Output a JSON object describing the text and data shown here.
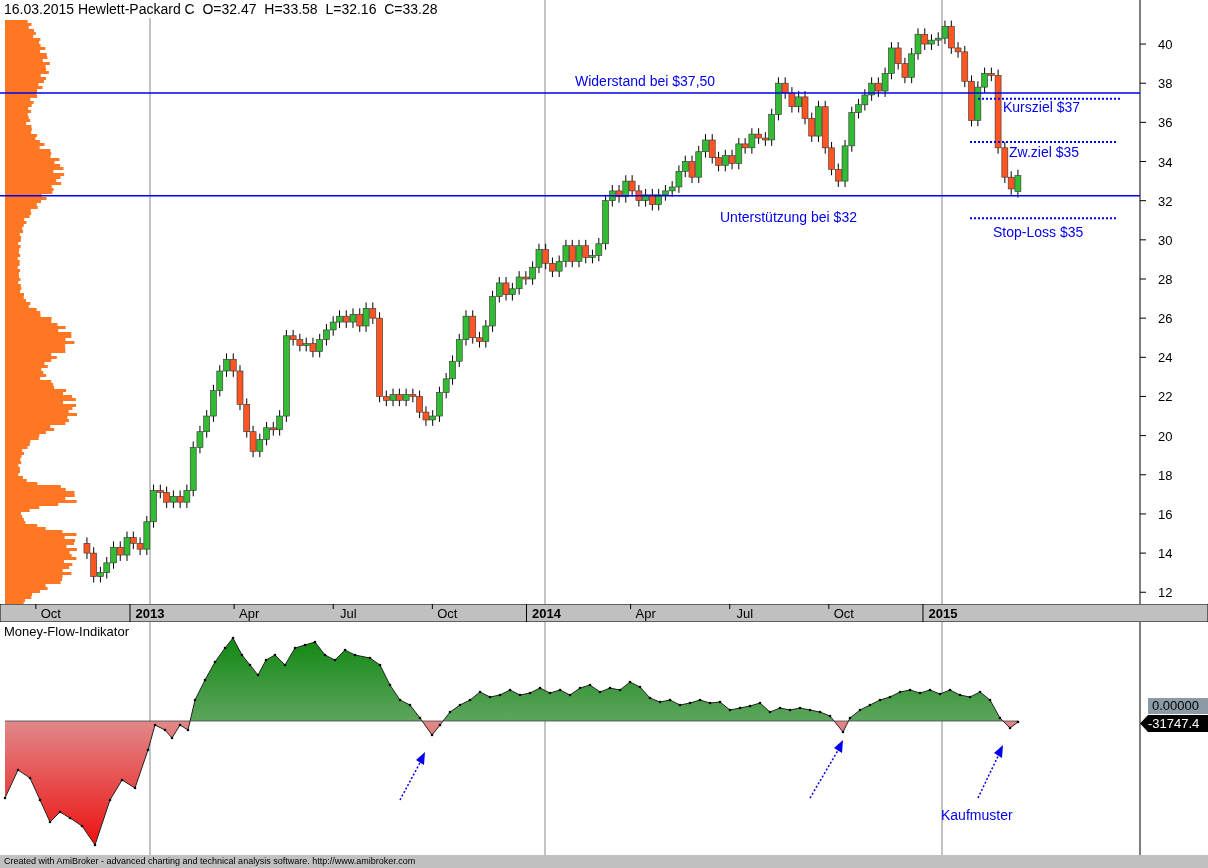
{
  "title": {
    "date": "16.03.2015",
    "symbol": "Hewlett-Packard C",
    "open": "O=32.47",
    "high": "H=33.58",
    "low": "L=32.16",
    "close": "C=33.28"
  },
  "price_chart": {
    "chart_data": {
      "type": "candlestick",
      "grid": true,
      "xlim": [
        2012.6217,
        2015.4969
      ],
      "ylim": [
        11.4,
        42.25
      ],
      "yticks": [
        12,
        14,
        16,
        18,
        20,
        22,
        24,
        26,
        28,
        30,
        32,
        34,
        36,
        38,
        40
      ],
      "x": [
        2012.841,
        2012.858,
        2012.875,
        2012.891,
        2012.908,
        2012.925,
        2012.942,
        2012.958,
        2012.975,
        2012.992,
        2013.009,
        2013.026,
        2013.042,
        2013.059,
        2013.076,
        2013.093,
        2013.109,
        2013.126,
        2013.143,
        2013.16,
        2013.176,
        2013.193,
        2013.21,
        2013.227,
        2013.244,
        2013.26,
        2013.277,
        2013.294,
        2013.311,
        2013.327,
        2013.344,
        2013.361,
        2013.378,
        2013.394,
        2013.411,
        2013.428,
        2013.445,
        2013.462,
        2013.478,
        2013.495,
        2013.512,
        2013.529,
        2013.545,
        2013.562,
        2013.579,
        2013.596,
        2013.613,
        2013.629,
        2013.646,
        2013.663,
        2013.68,
        2013.696,
        2013.713,
        2013.73,
        2013.747,
        2013.763,
        2013.78,
        2013.797,
        2013.814,
        2013.831,
        2013.847,
        2013.864,
        2013.881,
        2013.898,
        2013.914,
        2013.931,
        2013.948,
        2013.965,
        2013.981,
        2013.998,
        2014.015,
        2014.032,
        2014.049,
        2014.065,
        2014.082,
        2014.099,
        2014.116,
        2014.132,
        2014.149,
        2014.166,
        2014.183,
        2014.2,
        2014.216,
        2014.233,
        2014.25,
        2014.267,
        2014.283,
        2014.3,
        2014.317,
        2014.334,
        2014.35,
        2014.367,
        2014.384,
        2014.401,
        2014.418,
        2014.434,
        2014.451,
        2014.468,
        2014.485,
        2014.501,
        2014.518,
        2014.535,
        2014.552,
        2014.568,
        2014.585,
        2014.602,
        2014.619,
        2014.636,
        2014.652,
        2014.669,
        2014.686,
        2014.703,
        2014.719,
        2014.736,
        2014.753,
        2014.77,
        2014.787,
        2014.803,
        2014.82,
        2014.837,
        2014.854,
        2014.87,
        2014.887,
        2014.904,
        2014.921,
        2014.937,
        2014.954,
        2014.971,
        2014.988,
        2015.005,
        2015.021,
        2015.038,
        2015.055,
        2015.072,
        2015.088,
        2015.105,
        2015.122,
        2015.139,
        2015.156,
        2015.172,
        2015.189
      ],
      "ohlc": [
        [
          14.5,
          14.8,
          13.7,
          14.0
        ],
        [
          14.0,
          14.3,
          12.5,
          12.8
        ],
        [
          12.8,
          13.3,
          12.5,
          13.0
        ],
        [
          13.0,
          13.8,
          12.7,
          13.5
        ],
        [
          13.5,
          14.6,
          13.2,
          14.3
        ],
        [
          14.3,
          14.6,
          13.6,
          13.9
        ],
        [
          13.9,
          15.1,
          13.6,
          14.8
        ],
        [
          14.8,
          15.1,
          14.2,
          14.5
        ],
        [
          14.5,
          14.8,
          13.9,
          14.2
        ],
        [
          14.2,
          15.9,
          13.9,
          15.6
        ],
        [
          15.6,
          17.5,
          15.3,
          17.2
        ],
        [
          17.2,
          17.5,
          16.8,
          17.1
        ],
        [
          17.1,
          17.4,
          16.3,
          16.6
        ],
        [
          16.6,
          17.2,
          16.3,
          16.9
        ],
        [
          16.9,
          17.2,
          16.3,
          16.6
        ],
        [
          16.6,
          17.5,
          16.3,
          17.2
        ],
        [
          17.2,
          19.7,
          16.9,
          19.4
        ],
        [
          19.4,
          20.5,
          19.1,
          20.2
        ],
        [
          20.2,
          21.3,
          19.9,
          21.0
        ],
        [
          21.0,
          22.6,
          20.7,
          22.3
        ],
        [
          22.3,
          23.6,
          22.0,
          23.3
        ],
        [
          23.3,
          24.2,
          23.0,
          23.9
        ],
        [
          23.9,
          24.2,
          23.0,
          23.3
        ],
        [
          23.3,
          23.6,
          21.3,
          21.6
        ],
        [
          21.6,
          21.9,
          19.9,
          20.2
        ],
        [
          20.2,
          20.5,
          18.9,
          19.2
        ],
        [
          19.2,
          20.1,
          18.9,
          19.8
        ],
        [
          19.8,
          20.7,
          19.5,
          20.4
        ],
        [
          20.4,
          20.7,
          20.0,
          20.3
        ],
        [
          20.3,
          21.3,
          20.0,
          21.0
        ],
        [
          21.0,
          25.4,
          20.7,
          25.1
        ],
        [
          25.1,
          25.4,
          24.6,
          24.9
        ],
        [
          24.9,
          25.2,
          24.3,
          24.6
        ],
        [
          24.6,
          25.0,
          24.3,
          24.7
        ],
        [
          24.7,
          25.0,
          24.0,
          24.3
        ],
        [
          24.3,
          25.2,
          24.0,
          24.9
        ],
        [
          24.9,
          25.7,
          24.6,
          25.4
        ],
        [
          25.4,
          26.1,
          25.1,
          25.8
        ],
        [
          25.8,
          26.4,
          25.5,
          26.1
        ],
        [
          26.1,
          26.4,
          25.5,
          25.8
        ],
        [
          25.8,
          26.5,
          25.5,
          26.2
        ],
        [
          26.2,
          26.5,
          25.3,
          25.6
        ],
        [
          25.6,
          26.8,
          25.3,
          26.5
        ],
        [
          26.5,
          26.8,
          25.7,
          26.0
        ],
        [
          26.0,
          26.3,
          21.7,
          22.0
        ],
        [
          22.0,
          22.3,
          21.5,
          21.8
        ],
        [
          21.8,
          22.4,
          21.5,
          22.1
        ],
        [
          22.1,
          22.4,
          21.5,
          21.8
        ],
        [
          21.8,
          22.4,
          21.5,
          22.1
        ],
        [
          22.1,
          22.4,
          21.7,
          22.0
        ],
        [
          22.0,
          22.3,
          20.9,
          21.2
        ],
        [
          21.2,
          21.5,
          20.5,
          20.8
        ],
        [
          20.8,
          21.3,
          20.5,
          21.0
        ],
        [
          21.0,
          22.5,
          20.7,
          22.2
        ],
        [
          22.2,
          23.2,
          21.9,
          22.9
        ],
        [
          22.9,
          24.1,
          22.6,
          23.8
        ],
        [
          23.8,
          25.2,
          23.5,
          24.9
        ],
        [
          24.9,
          26.4,
          24.6,
          26.1
        ],
        [
          26.1,
          26.4,
          24.7,
          25.0
        ],
        [
          25.0,
          25.3,
          24.5,
          24.8
        ],
        [
          24.8,
          25.9,
          24.5,
          25.6
        ],
        [
          25.6,
          27.4,
          25.3,
          27.1
        ],
        [
          27.1,
          28.1,
          26.8,
          27.8
        ],
        [
          27.8,
          28.1,
          26.9,
          27.2
        ],
        [
          27.2,
          27.8,
          26.9,
          27.5
        ],
        [
          27.5,
          28.4,
          27.2,
          28.1
        ],
        [
          28.1,
          28.4,
          27.7,
          28.0
        ],
        [
          28.0,
          28.9,
          27.7,
          28.6
        ],
        [
          28.6,
          29.8,
          28.3,
          29.5
        ],
        [
          29.5,
          29.8,
          28.5,
          28.8
        ],
        [
          28.8,
          29.1,
          28.1,
          28.4
        ],
        [
          28.4,
          29.2,
          28.1,
          28.9
        ],
        [
          28.9,
          30.0,
          28.6,
          29.7
        ],
        [
          29.7,
          30.0,
          28.6,
          28.9
        ],
        [
          28.9,
          30.0,
          28.6,
          29.7
        ],
        [
          29.7,
          30.0,
          28.8,
          29.1
        ],
        [
          29.1,
          29.5,
          28.8,
          29.2
        ],
        [
          29.2,
          30.1,
          28.9,
          29.8
        ],
        [
          29.8,
          32.3,
          29.5,
          32.0
        ],
        [
          32.0,
          32.8,
          31.7,
          32.5
        ],
        [
          32.5,
          32.8,
          31.9,
          32.2
        ],
        [
          32.2,
          33.3,
          31.9,
          33.0
        ],
        [
          33.0,
          33.3,
          32.2,
          32.5
        ],
        [
          32.5,
          32.8,
          31.7,
          32.0
        ],
        [
          32.0,
          32.6,
          31.7,
          32.3
        ],
        [
          32.3,
          32.6,
          31.5,
          31.8
        ],
        [
          31.8,
          32.6,
          31.5,
          32.3
        ],
        [
          32.3,
          32.8,
          32.0,
          32.5
        ],
        [
          32.5,
          33.0,
          32.2,
          32.7
        ],
        [
          32.7,
          33.8,
          32.4,
          33.5
        ],
        [
          33.5,
          34.3,
          33.2,
          34.0
        ],
        [
          34.0,
          34.3,
          32.9,
          33.2
        ],
        [
          33.2,
          34.8,
          32.9,
          34.5
        ],
        [
          34.5,
          35.4,
          34.2,
          35.1
        ],
        [
          35.1,
          35.4,
          33.9,
          34.2
        ],
        [
          34.2,
          34.5,
          33.5,
          33.8
        ],
        [
          33.8,
          34.6,
          33.5,
          34.3
        ],
        [
          34.3,
          34.6,
          33.6,
          33.9
        ],
        [
          33.9,
          35.2,
          33.6,
          34.9
        ],
        [
          34.9,
          35.2,
          34.4,
          34.7
        ],
        [
          34.7,
          35.7,
          34.4,
          35.4
        ],
        [
          35.4,
          35.7,
          34.9,
          35.2
        ],
        [
          35.2,
          35.5,
          34.8,
          35.1
        ],
        [
          35.1,
          36.7,
          34.8,
          36.4
        ],
        [
          36.4,
          38.3,
          36.1,
          38.0
        ],
        [
          38.0,
          38.3,
          37.2,
          37.5
        ],
        [
          37.5,
          37.8,
          36.5,
          36.8
        ],
        [
          36.8,
          37.6,
          36.5,
          37.3
        ],
        [
          37.3,
          37.6,
          35.9,
          36.2
        ],
        [
          36.2,
          36.5,
          35.0,
          35.3
        ],
        [
          35.3,
          37.1,
          35.0,
          36.8
        ],
        [
          36.8,
          37.1,
          34.4,
          34.7
        ],
        [
          34.7,
          35.0,
          33.3,
          33.6
        ],
        [
          33.6,
          33.9,
          32.7,
          33.0
        ],
        [
          33.0,
          35.1,
          32.7,
          34.8
        ],
        [
          34.8,
          36.8,
          34.5,
          36.5
        ],
        [
          36.5,
          37.2,
          36.2,
          36.9
        ],
        [
          36.9,
          37.7,
          36.6,
          37.4
        ],
        [
          37.4,
          38.3,
          37.1,
          38.0
        ],
        [
          38.0,
          38.3,
          37.3,
          37.6
        ],
        [
          37.6,
          38.8,
          37.3,
          38.5
        ],
        [
          38.5,
          40.1,
          38.2,
          39.8
        ],
        [
          39.8,
          40.1,
          38.7,
          39.0
        ],
        [
          39.0,
          39.3,
          38.0,
          38.3
        ],
        [
          38.3,
          39.8,
          38.0,
          39.5
        ],
        [
          39.5,
          40.8,
          39.2,
          40.5
        ],
        [
          40.5,
          40.8,
          39.7,
          40.0
        ],
        [
          40.0,
          40.5,
          39.7,
          40.2
        ],
        [
          40.2,
          40.6,
          39.9,
          40.3
        ],
        [
          40.3,
          41.2,
          40.0,
          40.9
        ],
        [
          40.9,
          41.2,
          39.5,
          39.8
        ],
        [
          39.8,
          40.1,
          39.3,
          39.6
        ],
        [
          39.6,
          39.9,
          37.8,
          38.1
        ],
        [
          38.1,
          38.4,
          35.8,
          36.1
        ],
        [
          36.1,
          38.1,
          35.8,
          37.8
        ],
        [
          37.8,
          38.8,
          37.5,
          38.5
        ],
        [
          38.5,
          38.8,
          38.1,
          38.4
        ],
        [
          38.4,
          38.7,
          34.4,
          34.7
        ],
        [
          34.7,
          35.0,
          32.9,
          33.2
        ],
        [
          33.2,
          33.5,
          32.3,
          32.6
        ],
        [
          32.47,
          33.58,
          32.16,
          33.28
        ]
      ],
      "xticks": [
        {
          "value": 2012.75,
          "label": "Oct"
        },
        {
          "value": 2013,
          "label": "2013"
        },
        {
          "value": 2013.25,
          "label": "Apr"
        },
        {
          "value": 2013.5,
          "label": "Jul"
        },
        {
          "value": 2013.75,
          "label": "Oct"
        },
        {
          "value": 2014,
          "label": "2014"
        },
        {
          "value": 2014.25,
          "label": "Apr"
        },
        {
          "value": 2014.5,
          "label": "Jul"
        },
        {
          "value": 2014.75,
          "label": "Oct"
        },
        {
          "value": 2015,
          "label": "2015"
        }
      ],
      "ref_lines": [
        {
          "axis": "y",
          "value": 37.5
        },
        {
          "axis": "y",
          "value": 37.2
        },
        {
          "axis": "y",
          "value": 35.0
        },
        {
          "axis": "y",
          "value": 32.25
        },
        {
          "axis": "y",
          "value": 31.1
        }
      ],
      "annotations": [
        {
          "text": "Widerstand bei $37,50"
        },
        {
          "text": "Kursziel $37"
        },
        {
          "text": "Zw.ziel $35"
        },
        {
          "text": "Unterstützung bei $32"
        },
        {
          "text": "Stop-Loss $35"
        }
      ]
    }
  },
  "time_axis": [
    {
      "kind": "month"
    },
    {
      "kind": "year"
    },
    {
      "kind": "month"
    },
    {
      "kind": "month"
    },
    {
      "kind": "month"
    },
    {
      "kind": "year"
    },
    {
      "kind": "month"
    },
    {
      "kind": "month"
    },
    {
      "kind": "month"
    },
    {
      "kind": "year"
    }
  ],
  "indicator": {
    "title": "Money-Flow-Indikator",
    "zero_label": "0.00000",
    "value_label": "-31747.4",
    "annotation": "Kaufmuster"
  },
  "footer": "Created with AmiBroker - advanced charting and technical analysis software. http://www.amibroker.com"
}
